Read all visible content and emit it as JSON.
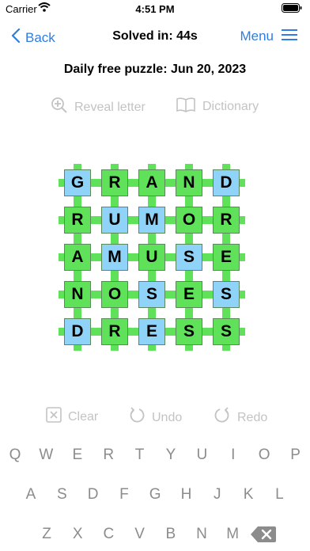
{
  "status": {
    "carrier": "Carrier",
    "time": "4:51 PM"
  },
  "nav": {
    "back_label": "Back",
    "title": "Solved in: 44s",
    "menu_label": "Menu"
  },
  "puzzle": {
    "date_label": "Daily free puzzle: Jun 20, 2023"
  },
  "tools": {
    "reveal_label": "Reveal letter",
    "dictionary_label": "Dictionary"
  },
  "colors": {
    "tile_green": "#5fe25a",
    "tile_blue": "#8fd3f8",
    "accent_blue": "#2f7de1"
  },
  "grid": [
    [
      {
        "l": "G",
        "c": "blue"
      },
      {
        "l": "R",
        "c": "green"
      },
      {
        "l": "A",
        "c": "green"
      },
      {
        "l": "N",
        "c": "green"
      },
      {
        "l": "D",
        "c": "blue"
      }
    ],
    [
      {
        "l": "R",
        "c": "green"
      },
      {
        "l": "U",
        "c": "blue"
      },
      {
        "l": "M",
        "c": "blue"
      },
      {
        "l": "O",
        "c": "green"
      },
      {
        "l": "R",
        "c": "green"
      }
    ],
    [
      {
        "l": "A",
        "c": "green"
      },
      {
        "l": "M",
        "c": "blue"
      },
      {
        "l": "U",
        "c": "green"
      },
      {
        "l": "S",
        "c": "blue"
      },
      {
        "l": "E",
        "c": "green"
      }
    ],
    [
      {
        "l": "N",
        "c": "green"
      },
      {
        "l": "O",
        "c": "green"
      },
      {
        "l": "S",
        "c": "blue"
      },
      {
        "l": "E",
        "c": "green"
      },
      {
        "l": "S",
        "c": "blue"
      }
    ],
    [
      {
        "l": "D",
        "c": "blue"
      },
      {
        "l": "R",
        "c": "green"
      },
      {
        "l": "E",
        "c": "blue"
      },
      {
        "l": "S",
        "c": "green"
      },
      {
        "l": "S",
        "c": "green"
      }
    ]
  ],
  "actions": {
    "clear_label": "Clear",
    "undo_label": "Undo",
    "redo_label": "Redo"
  },
  "keyboard": {
    "row1": [
      "Q",
      "W",
      "E",
      "R",
      "T",
      "Y",
      "U",
      "I",
      "O",
      "P"
    ],
    "row2": [
      "A",
      "S",
      "D",
      "F",
      "G",
      "H",
      "J",
      "K",
      "L"
    ],
    "row3": [
      "Z",
      "X",
      "C",
      "V",
      "B",
      "N",
      "M"
    ]
  }
}
